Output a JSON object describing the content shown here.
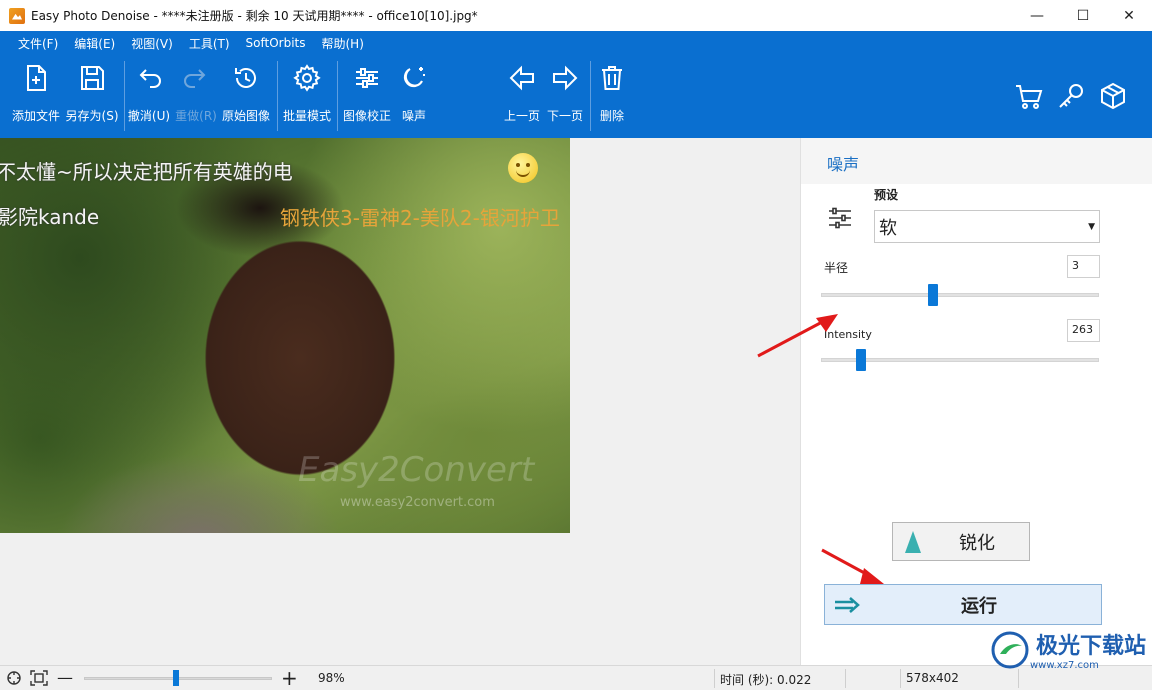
{
  "window": {
    "title": "Easy Photo Denoise - ****未注册版 - 剩余 10 天试用期**** - office10[10].jpg*",
    "minimize_icon": "—",
    "maximize_icon": "☐",
    "close_icon": "✕"
  },
  "menu": [
    "文件(F)",
    "编辑(E)",
    "视图(V)",
    "工具(T)",
    "SoftOrbits",
    "帮助(H)"
  ],
  "toolbar": {
    "add_file": "添加文件",
    "save_as": "另存为(S)",
    "undo": "撤消(U)",
    "redo": "重做(R)",
    "original": "原始图像",
    "batch": "批量模式",
    "correction": "图像校正",
    "noise": "噪声",
    "prev": "上一页",
    "next": "下一页",
    "delete": "删除"
  },
  "canvas": {
    "overlay_line1": "不太懂~所以决定把所有英雄的电",
    "overlay_line2": "影院kande",
    "overlay_line3": "钢铁侠3-雷神2-美队2-银河护卫",
    "watermark_big": "Easy2Convert",
    "watermark_url": "www.easy2convert.com"
  },
  "panel": {
    "title": "噪声",
    "preset_label": "预设",
    "preset_value": "软",
    "radius_label": "半径",
    "radius_value": "3",
    "radius_fraction": 0.4,
    "intensity_label": "Intensity",
    "intensity_value": "263",
    "sharpen_button": "锐化",
    "run_button": "运行"
  },
  "status": {
    "zoom": "98%",
    "time": "时间 (秒): 0.022",
    "size": "578x402"
  },
  "brand": {
    "name": "极光下载站",
    "url": "www.xz7.com"
  },
  "colors": {
    "ribbon": "#0a6fd0",
    "accent": "#0a78d7",
    "arrow": "#e11a1a"
  }
}
